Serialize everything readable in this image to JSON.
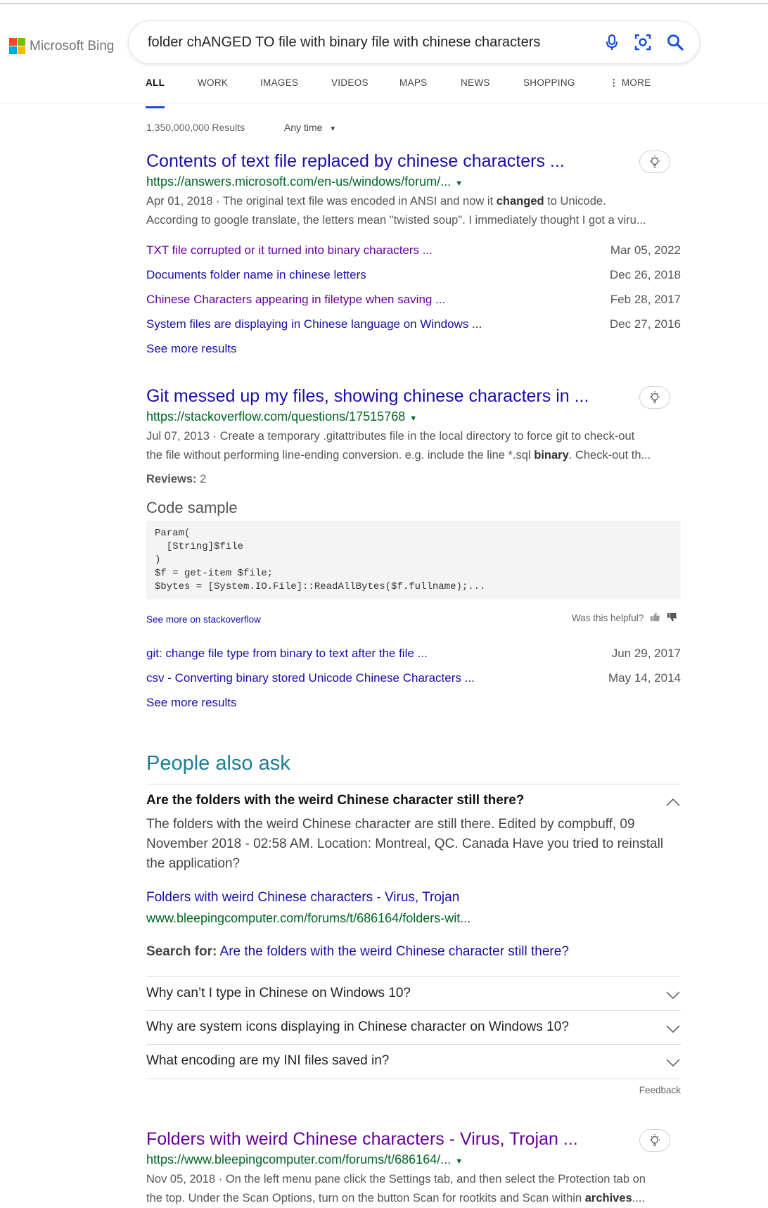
{
  "brand": {
    "name": "Microsoft Bing",
    "colors": [
      "#f25022",
      "#7fba00",
      "#00a4ef",
      "#ffb900"
    ]
  },
  "search": {
    "query": "folder chANGED TO file with binary file with chinese characters",
    "icons": [
      "microphone-icon",
      "visual-search-icon",
      "search-icon"
    ]
  },
  "tabs": [
    "ALL",
    "WORK",
    "IMAGES",
    "VIDEOS",
    "MAPS",
    "NEWS",
    "SHOPPING",
    "MORE"
  ],
  "active_tab": "ALL",
  "meta": {
    "results_count": "1,350,000,000 Results",
    "time_filter": "Any time"
  },
  "results": [
    {
      "title": "Contents of text file replaced by chinese characters ...",
      "url": "https://answers.microsoft.com/en-us/windows/forum/...",
      "snippet_1": "Apr 01, 2018 · The original text file was encoded in ANSI and now it ",
      "snippet_bold": "changed",
      "snippet_2": " to Unicode.",
      "snippet_line2": "According to google translate, the letters mean \"twisted soup\". I immediately thought I got a viru...",
      "deeplinks": [
        {
          "text": "TXT file corrupted or it turned into binary characters ...",
          "date": "Mar 05, 2022",
          "visited": true
        },
        {
          "text": "Documents folder name in chinese letters",
          "date": "Dec 26, 2018",
          "visited": false
        },
        {
          "text": "Chinese Characters appearing in filetype when saving ...",
          "date": "Feb 28, 2017",
          "visited": true
        },
        {
          "text": "System files are displaying in Chinese language on Windows ...",
          "date": "Dec 27, 2016",
          "visited": false
        }
      ],
      "see_more": "See more results"
    },
    {
      "title": "Git messed up my files, showing chinese characters in ...",
      "url": "https://stackoverflow.com/questions/17515768",
      "snippet_1": "Jul 07, 2013 · Create a temporary .gitattributes file in the local directory to force git to check-out",
      "snippet_line2a": "the file without performing line-ending conversion. e.g. include the line *.sql ",
      "snippet_bold": "binary",
      "snippet_line2b": ". Check-out th...",
      "reviews_label": "Reviews:",
      "reviews_value": "2",
      "code_label": "Code sample",
      "code": "Param(\n  [String]$file\n)\n$f = get-item $file;\n$bytes = [System.IO.File]::ReadAllBytes($f.fullname);...",
      "see_more_on": "See more on stackoverflow",
      "helpful": "Was this helpful?",
      "deeplinks": [
        {
          "text": "git: change file type from binary to text after the file ...",
          "date": "Jun 29, 2017"
        },
        {
          "text": "csv - Converting binary stored Unicode Chinese Characters ...",
          "date": "May 14, 2014"
        }
      ],
      "see_more": "See more results"
    },
    {
      "title": "Folders with weird Chinese characters - Virus, Trojan ...",
      "url": "https://www.bleepingcomputer.com/forums/t/686164/...",
      "snippet_1": "Nov 05, 2018 · On the left menu pane click the Settings tab, and then select the Protection tab on",
      "snippet_line2a": "the top. Under the Scan Options, turn on the button Scan for rootkits and Scan within ",
      "snippet_bold": "archives",
      "snippet_line2b": "...."
    }
  ],
  "paa": {
    "title": "People also ask",
    "open_question": "Are the folders with the weird Chinese character still there?",
    "answer": "The folders with the weird Chinese character are still there. Edited by compbuff, 09 November 2018 - 02:58 AM. Location: Montreal, QC. Canada Have you tried to reinstall the application?",
    "source_title": "Folders with weird Chinese characters - Virus, Trojan",
    "source_url": "www.bleepingcomputer.com/forums/t/686164/folders-wit...",
    "search_for_label": "Search for:",
    "search_for_query": "Are the folders with the weird Chinese character still there?",
    "questions": [
      "Why can’t I type in Chinese on Windows 10?",
      "Why are system icons displaying in Chinese character on Windows 10?",
      "What encoding are my INI files saved in?"
    ],
    "feedback": "Feedback"
  }
}
